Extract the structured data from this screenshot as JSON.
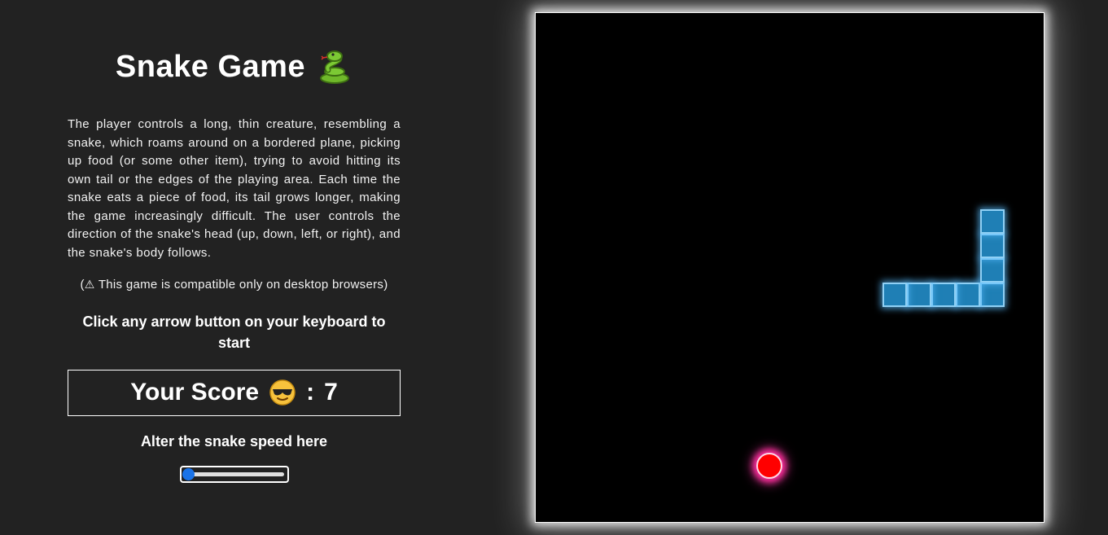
{
  "title": "Snake Game",
  "description": "The player controls a long, thin creature, resembling a snake, which roams around on a bordered plane, picking up food (or some other item), trying to avoid hitting its own tail or the edges of the playing area. Each time the snake eats a piece of food, its tail grows longer, making the game increasingly difficult. The user controls the direction of the snake's head (up, down, left, or right), and the snake's body follows.",
  "note": {
    "open": "(",
    "icon": "⚠",
    "text": " This game is compatible only on desktop browsers)"
  },
  "instruction": "Click any arrow button on your keyboard to start",
  "score": {
    "label": "Your Score",
    "separator": ":",
    "value": "7"
  },
  "speed": {
    "label": "Alter the snake speed here",
    "level": 0
  },
  "board": {
    "grid_cols": 21,
    "grid_rows": 21,
    "snake": [
      [
        18,
        11
      ],
      [
        17,
        11
      ],
      [
        16,
        11
      ],
      [
        15,
        11
      ],
      [
        14,
        11
      ],
      [
        18,
        10
      ],
      [
        18,
        9
      ],
      [
        18,
        8
      ]
    ],
    "food": [
      9,
      18
    ]
  },
  "colors": {
    "background": "#222222",
    "board": "#000000",
    "snake": "#1f7fb5",
    "snake_border": "#8fd0f5",
    "food": "#ff0000",
    "food_glow": "#ff2d9c",
    "slider": "#1a73e8"
  },
  "icons": {
    "title_icon": "snake-icon",
    "score_icon": "cool-face-icon",
    "note_icon": "warning-icon"
  }
}
